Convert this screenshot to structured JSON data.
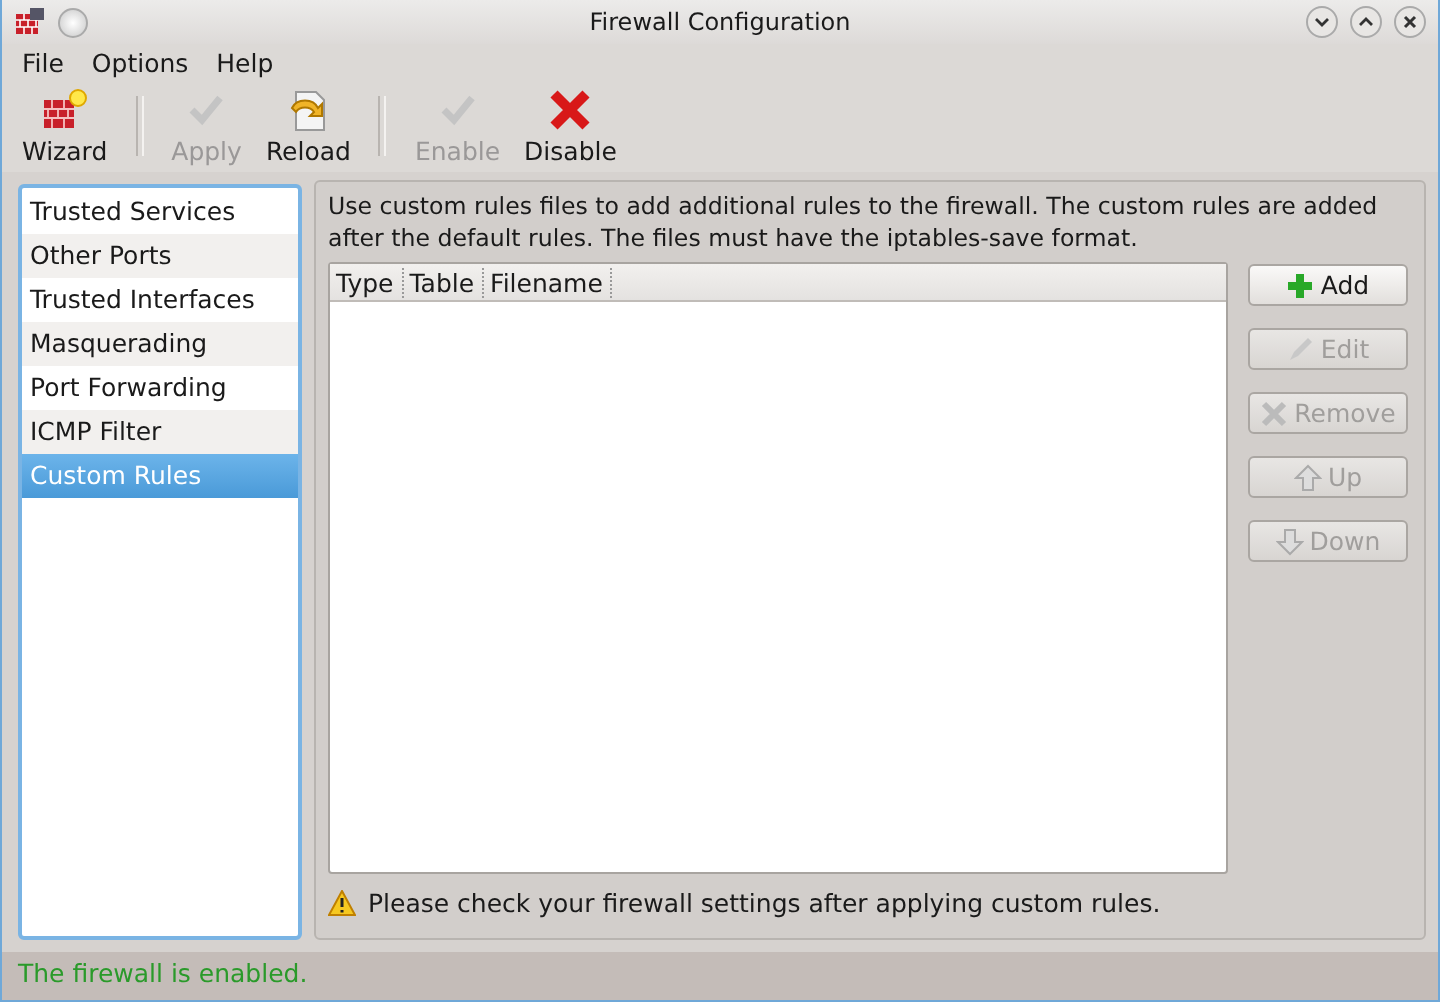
{
  "window": {
    "title": "Firewall Configuration"
  },
  "menu": [
    "File",
    "Options",
    "Help"
  ],
  "toolbar": [
    {
      "label": "Wizard",
      "kind": "wizard",
      "disabled": false
    },
    {
      "kind": "separator"
    },
    {
      "label": "Apply",
      "kind": "check",
      "disabled": true
    },
    {
      "label": "Reload",
      "kind": "reload",
      "disabled": false
    },
    {
      "kind": "separator"
    },
    {
      "label": "Enable",
      "kind": "check",
      "disabled": true
    },
    {
      "label": "Disable",
      "kind": "cross",
      "disabled": false
    }
  ],
  "sidebar": {
    "items": [
      {
        "label": "Trusted Services",
        "selected": false
      },
      {
        "label": "Other Ports",
        "selected": false
      },
      {
        "label": "Trusted Interfaces",
        "selected": false
      },
      {
        "label": "Masquerading",
        "selected": false
      },
      {
        "label": "Port Forwarding",
        "selected": false
      },
      {
        "label": "ICMP Filter",
        "selected": false
      },
      {
        "label": "Custom Rules",
        "selected": true
      }
    ]
  },
  "description": "Use custom rules files to add additional rules to the firewall. The custom rules are added after the default rules. The files must have the iptables-save format.",
  "table": {
    "columns": [
      "Type",
      "Table",
      "Filename"
    ]
  },
  "buttons": [
    {
      "label": "Add",
      "kind": "add",
      "disabled": false
    },
    {
      "label": "Edit",
      "kind": "edit",
      "disabled": true
    },
    {
      "label": "Remove",
      "kind": "remove",
      "disabled": true
    },
    {
      "label": "Up",
      "kind": "up",
      "disabled": true
    },
    {
      "label": "Down",
      "kind": "down",
      "disabled": true
    }
  ],
  "warning": "Please check your firewall settings after applying custom rules.",
  "status_bar": "The firewall is enabled."
}
